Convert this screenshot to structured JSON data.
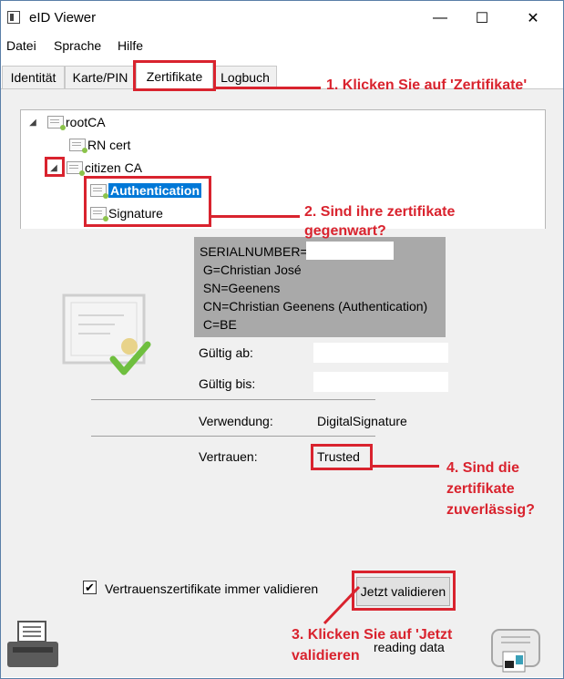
{
  "window": {
    "title": "eID Viewer",
    "minimize": "—",
    "maximize": "☐",
    "close": "✕"
  },
  "menu": [
    "Datei",
    "Sprache",
    "Hilfe"
  ],
  "tabs": [
    "Identität",
    "Karte/PIN",
    "Zertifikate",
    "Logbuch"
  ],
  "tree": {
    "root": "rootCA",
    "rn": "RN cert",
    "citizen": "citizen CA",
    "auth": "Authentication",
    "signature": "Signature"
  },
  "subject": "SERIALNUMBER=\n G=Christian José\n SN=Geenens\n CN=Christian Geenens (Authentication)\n C=BE",
  "fields": {
    "valid_from_label": "Gültig ab:",
    "valid_to_label": "Gültig bis:",
    "usage_label": "Verwendung:",
    "usage_value": "DigitalSignature",
    "trust_label": "Vertrauen:",
    "trust_value": "Trusted"
  },
  "always_validate_label": "Vertrauenszertifikate immer validieren",
  "validate_button": "Jetzt validieren",
  "status": "reading data",
  "annotations": {
    "a1": "1. Klicken Sie auf 'Zertifikate'",
    "a2_line1": "2. Sind ihre zertifikate",
    "a2_line2": "gegenwart?",
    "a3_line1": "3. Klicken Sie auf 'Jetzt",
    "a3_line2": "validieren",
    "a4_line1": "4. Sind die",
    "a4_line2": "zertifikate",
    "a4_line3": "zuverlässig?"
  },
  "colors": {
    "annotation": "#d9232e",
    "selection": "#0078d7",
    "subject_bg": "#a9a9a9"
  }
}
